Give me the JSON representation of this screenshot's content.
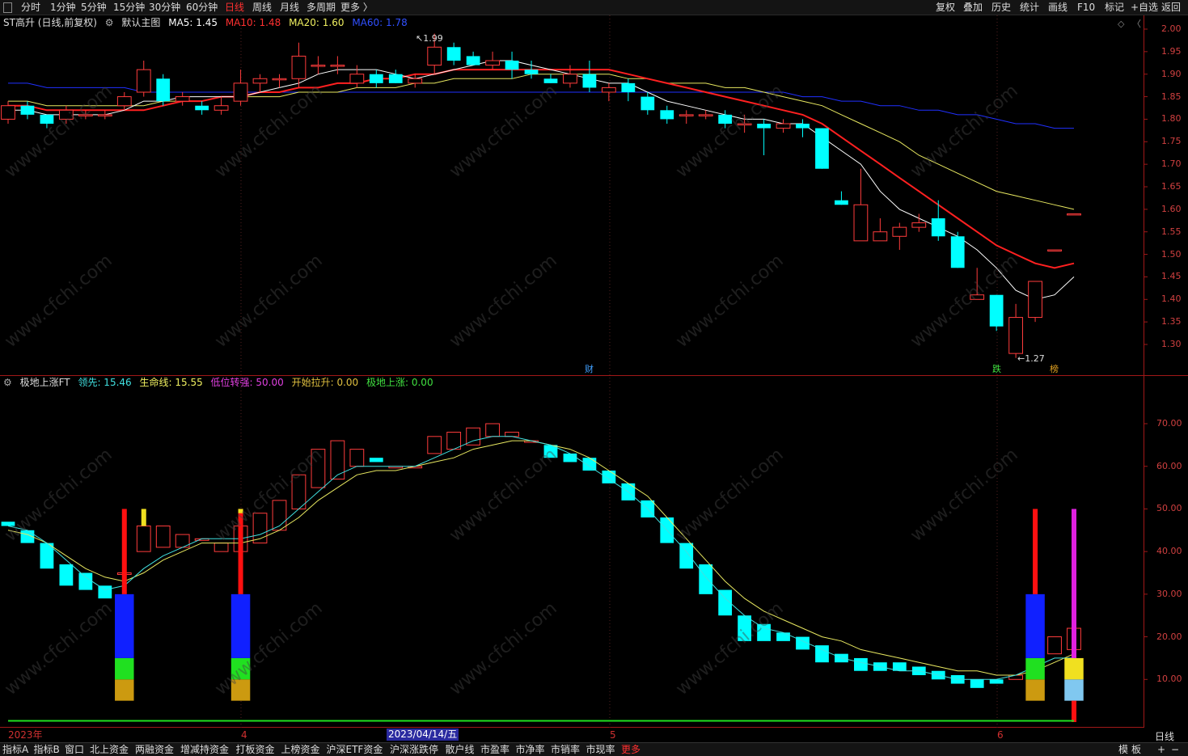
{
  "toolbar": {
    "tabs": [
      "分时",
      "1分钟",
      "5分钟",
      "15分钟",
      "30分钟",
      "60分钟",
      "日线",
      "周线",
      "月线",
      "多周期",
      "更多 〉"
    ],
    "active_tab": "日线",
    "right": [
      "复权",
      "叠加",
      "历史",
      "统计",
      "画线",
      "F10",
      "标记",
      "+自选",
      "返回"
    ]
  },
  "main_chart": {
    "title": "ST高升 (日线,前复权)",
    "template": "默认主图",
    "ma5": "MA5: 1.45",
    "ma10": "MA10: 1.48",
    "ma20": "MA20: 1.60",
    "ma60": "MA60: 1.78",
    "high_label": "1.99",
    "low_label": "1.27",
    "event_marks": [
      "财",
      "跌",
      "榜"
    ],
    "y_ticks": [
      "2.00",
      "1.95",
      "1.90",
      "1.85",
      "1.80",
      "1.75",
      "1.70",
      "1.65",
      "1.60",
      "1.55",
      "1.50",
      "1.45",
      "1.40",
      "1.35",
      "1.30"
    ]
  },
  "indicator": {
    "name": "极地上涨FT",
    "lingxian": "领先: 15.46",
    "shengming": "生命线: 15.55",
    "diwei": "低位转强: 50.00",
    "kaishi": "开始拉升: 0.00",
    "jidi": "极地上涨: 0.00",
    "y_ticks": [
      "70.00",
      "60.00",
      "50.00",
      "40.00",
      "30.00",
      "20.00",
      "10.00"
    ]
  },
  "x_axis": {
    "labels": [
      "2023年",
      "4",
      "5",
      "6"
    ],
    "cursor_date": "2023/04/14/五",
    "period": "日线"
  },
  "bottom_tabs": [
    "指标A",
    "指标B",
    "窗口",
    "北上资金",
    "两融资金",
    "增减持资金",
    "打板资金",
    "上榜资金",
    "沪深ETF资金",
    "沪深涨跌停",
    "散户线",
    "市盈率",
    "市净率",
    "市销率",
    "市现率",
    "更多"
  ],
  "bottom_right": [
    "模",
    "板",
    "+",
    "−"
  ],
  "watermark": "www.cfchi.com",
  "colors": {
    "up": "#ff3c3c",
    "down": "#00ffff",
    "ma5": "#ffffff",
    "ma10": "#ff2020",
    "ma20": "#e8e860",
    "ma60": "#2030ff"
  },
  "chart_data": [
    {
      "type": "candlestick",
      "ylim": [
        1.25,
        2.02
      ],
      "candles": [
        {
          "o": 1.8,
          "h": 1.84,
          "l": 1.79,
          "c": 1.83
        },
        {
          "o": 1.83,
          "h": 1.84,
          "l": 1.8,
          "c": 1.81
        },
        {
          "o": 1.81,
          "h": 1.81,
          "l": 1.78,
          "c": 1.79
        },
        {
          "o": 1.8,
          "h": 1.83,
          "l": 1.79,
          "c": 1.82
        },
        {
          "o": 1.81,
          "h": 1.82,
          "l": 1.8,
          "c": 1.81
        },
        {
          "o": 1.81,
          "h": 1.82,
          "l": 1.8,
          "c": 1.81
        },
        {
          "o": 1.83,
          "h": 1.86,
          "l": 1.82,
          "c": 1.85
        },
        {
          "o": 1.86,
          "h": 1.93,
          "l": 1.85,
          "c": 1.91
        },
        {
          "o": 1.89,
          "h": 1.9,
          "l": 1.83,
          "c": 1.84
        },
        {
          "o": 1.84,
          "h": 1.86,
          "l": 1.83,
          "c": 1.85
        },
        {
          "o": 1.83,
          "h": 1.84,
          "l": 1.81,
          "c": 1.82
        },
        {
          "o": 1.82,
          "h": 1.85,
          "l": 1.81,
          "c": 1.83
        },
        {
          "o": 1.84,
          "h": 1.91,
          "l": 1.83,
          "c": 1.88
        },
        {
          "o": 1.88,
          "h": 1.9,
          "l": 1.86,
          "c": 1.89
        },
        {
          "o": 1.89,
          "h": 1.9,
          "l": 1.87,
          "c": 1.89
        },
        {
          "o": 1.89,
          "h": 1.97,
          "l": 1.87,
          "c": 1.94
        },
        {
          "o": 1.92,
          "h": 1.94,
          "l": 1.9,
          "c": 1.92
        },
        {
          "o": 1.92,
          "h": 1.94,
          "l": 1.9,
          "c": 1.92
        },
        {
          "o": 1.88,
          "h": 1.92,
          "l": 1.87,
          "c": 1.9
        },
        {
          "o": 1.9,
          "h": 1.91,
          "l": 1.87,
          "c": 1.88
        },
        {
          "o": 1.9,
          "h": 1.91,
          "l": 1.88,
          "c": 1.88
        },
        {
          "o": 1.88,
          "h": 1.9,
          "l": 1.87,
          "c": 1.89
        },
        {
          "o": 1.92,
          "h": 1.99,
          "l": 1.9,
          "c": 1.96
        },
        {
          "o": 1.96,
          "h": 1.97,
          "l": 1.92,
          "c": 1.93
        },
        {
          "o": 1.94,
          "h": 1.95,
          "l": 1.92,
          "c": 1.92
        },
        {
          "o": 1.92,
          "h": 1.95,
          "l": 1.91,
          "c": 1.93
        },
        {
          "o": 1.93,
          "h": 1.95,
          "l": 1.89,
          "c": 1.91
        },
        {
          "o": 1.91,
          "h": 1.93,
          "l": 1.89,
          "c": 1.9
        },
        {
          "o": 1.89,
          "h": 1.9,
          "l": 1.88,
          "c": 1.88
        },
        {
          "o": 1.88,
          "h": 1.92,
          "l": 1.87,
          "c": 1.9
        },
        {
          "o": 1.9,
          "h": 1.93,
          "l": 1.86,
          "c": 1.87
        },
        {
          "o": 1.86,
          "h": 1.88,
          "l": 1.84,
          "c": 1.87
        },
        {
          "o": 1.88,
          "h": 1.89,
          "l": 1.84,
          "c": 1.86
        },
        {
          "o": 1.85,
          "h": 1.86,
          "l": 1.81,
          "c": 1.82
        },
        {
          "o": 1.82,
          "h": 1.83,
          "l": 1.79,
          "c": 1.8
        },
        {
          "o": 1.81,
          "h": 1.82,
          "l": 1.79,
          "c": 1.81
        },
        {
          "o": 1.81,
          "h": 1.82,
          "l": 1.8,
          "c": 1.81
        },
        {
          "o": 1.81,
          "h": 1.82,
          "l": 1.78,
          "c": 1.79
        },
        {
          "o": 1.79,
          "h": 1.81,
          "l": 1.77,
          "c": 1.79
        },
        {
          "o": 1.79,
          "h": 1.8,
          "l": 1.72,
          "c": 1.78
        },
        {
          "o": 1.78,
          "h": 1.8,
          "l": 1.77,
          "c": 1.79
        },
        {
          "o": 1.79,
          "h": 1.8,
          "l": 1.76,
          "c": 1.78
        },
        {
          "o": 1.78,
          "h": 1.78,
          "l": 1.69,
          "c": 1.69
        },
        {
          "o": 1.62,
          "h": 1.64,
          "l": 1.61,
          "c": 1.61
        },
        {
          "o": 1.53,
          "h": 1.69,
          "l": 1.53,
          "c": 1.61
        },
        {
          "o": 1.53,
          "h": 1.58,
          "l": 1.53,
          "c": 1.55
        },
        {
          "o": 1.54,
          "h": 1.57,
          "l": 1.51,
          "c": 1.56
        },
        {
          "o": 1.56,
          "h": 1.59,
          "l": 1.55,
          "c": 1.57
        },
        {
          "o": 1.58,
          "h": 1.62,
          "l": 1.53,
          "c": 1.54
        },
        {
          "o": 1.54,
          "h": 1.55,
          "l": 1.47,
          "c": 1.47
        },
        {
          "o": 1.4,
          "h": 1.47,
          "l": 1.4,
          "c": 1.41
        },
        {
          "o": 1.41,
          "h": 1.41,
          "l": 1.33,
          "c": 1.34
        },
        {
          "o": 1.28,
          "h": 1.39,
          "l": 1.27,
          "c": 1.36
        },
        {
          "o": 1.36,
          "h": 1.44,
          "l": 1.35,
          "c": 1.44
        },
        {
          "o": 1.51,
          "h": 1.51,
          "l": 1.51,
          "c": 1.51
        },
        {
          "o": 1.59,
          "h": 1.59,
          "l": 1.59,
          "c": 1.59
        }
      ],
      "ma5": [
        1.82,
        1.82,
        1.81,
        1.81,
        1.81,
        1.81,
        1.82,
        1.84,
        1.84,
        1.85,
        1.85,
        1.85,
        1.85,
        1.86,
        1.87,
        1.88,
        1.9,
        1.91,
        1.91,
        1.91,
        1.9,
        1.89,
        1.9,
        1.91,
        1.92,
        1.93,
        1.93,
        1.92,
        1.91,
        1.9,
        1.89,
        1.88,
        1.88,
        1.86,
        1.84,
        1.83,
        1.82,
        1.81,
        1.8,
        1.8,
        1.79,
        1.79,
        1.76,
        1.73,
        1.7,
        1.64,
        1.6,
        1.58,
        1.56,
        1.54,
        1.51,
        1.47,
        1.42,
        1.4,
        1.41,
        1.45
      ],
      "ma10": [
        1.83,
        1.83,
        1.82,
        1.82,
        1.82,
        1.82,
        1.82,
        1.82,
        1.83,
        1.84,
        1.84,
        1.85,
        1.85,
        1.86,
        1.86,
        1.87,
        1.87,
        1.88,
        1.88,
        1.89,
        1.89,
        1.9,
        1.9,
        1.91,
        1.91,
        1.91,
        1.91,
        1.91,
        1.91,
        1.91,
        1.91,
        1.91,
        1.9,
        1.89,
        1.88,
        1.87,
        1.86,
        1.85,
        1.84,
        1.83,
        1.82,
        1.81,
        1.79,
        1.76,
        1.73,
        1.7,
        1.67,
        1.64,
        1.61,
        1.58,
        1.55,
        1.52,
        1.5,
        1.48,
        1.47,
        1.48
      ],
      "ma20": [
        1.84,
        1.84,
        1.83,
        1.83,
        1.83,
        1.83,
        1.83,
        1.83,
        1.84,
        1.84,
        1.84,
        1.85,
        1.85,
        1.85,
        1.85,
        1.86,
        1.86,
        1.86,
        1.87,
        1.87,
        1.87,
        1.88,
        1.88,
        1.89,
        1.89,
        1.89,
        1.89,
        1.9,
        1.9,
        1.9,
        1.9,
        1.9,
        1.89,
        1.89,
        1.88,
        1.88,
        1.88,
        1.87,
        1.87,
        1.86,
        1.85,
        1.84,
        1.83,
        1.81,
        1.79,
        1.77,
        1.75,
        1.72,
        1.7,
        1.68,
        1.66,
        1.64,
        1.63,
        1.62,
        1.61,
        1.6
      ],
      "ma60": [
        1.88,
        1.88,
        1.87,
        1.87,
        1.87,
        1.87,
        1.87,
        1.86,
        1.86,
        1.86,
        1.86,
        1.86,
        1.86,
        1.86,
        1.86,
        1.86,
        1.86,
        1.86,
        1.86,
        1.86,
        1.86,
        1.86,
        1.86,
        1.86,
        1.86,
        1.86,
        1.86,
        1.86,
        1.86,
        1.86,
        1.86,
        1.86,
        1.86,
        1.86,
        1.86,
        1.86,
        1.86,
        1.86,
        1.86,
        1.86,
        1.86,
        1.85,
        1.85,
        1.84,
        1.84,
        1.83,
        1.83,
        1.82,
        1.82,
        1.81,
        1.81,
        1.8,
        1.79,
        1.79,
        1.78,
        1.78
      ]
    },
    {
      "type": "bar",
      "ylim": [
        0,
        80
      ],
      "bars": [
        {
          "o": 47,
          "c": 46
        },
        {
          "o": 45,
          "c": 42
        },
        {
          "o": 42,
          "c": 36
        },
        {
          "o": 37,
          "c": 32
        },
        {
          "o": 35,
          "c": 31
        },
        {
          "o": 32,
          "c": 29
        },
        {
          "o": 35,
          "c": 35
        },
        {
          "o": 40,
          "c": 46
        },
        {
          "o": 41,
          "c": 46
        },
        {
          "o": 41,
          "c": 44
        },
        {
          "o": 43,
          "c": 43
        },
        {
          "o": 40,
          "c": 42
        },
        {
          "o": 40,
          "c": 46
        },
        {
          "o": 42,
          "c": 49
        },
        {
          "o": 45,
          "c": 52
        },
        {
          "o": 50,
          "c": 58
        },
        {
          "o": 55,
          "c": 64
        },
        {
          "o": 57,
          "c": 66
        },
        {
          "o": 60,
          "c": 64
        },
        {
          "o": 62,
          "c": 61
        },
        {
          "o": 60,
          "c": 60
        },
        {
          "o": 60,
          "c": 60
        },
        {
          "o": 63,
          "c": 67
        },
        {
          "o": 64,
          "c": 68
        },
        {
          "o": 65,
          "c": 69
        },
        {
          "o": 67,
          "c": 70
        },
        {
          "o": 67,
          "c": 68
        },
        {
          "o": 66,
          "c": 66
        },
        {
          "o": 65,
          "c": 62
        },
        {
          "o": 63,
          "c": 61
        },
        {
          "o": 62,
          "c": 59
        },
        {
          "o": 59,
          "c": 56
        },
        {
          "o": 56,
          "c": 52
        },
        {
          "o": 52,
          "c": 48
        },
        {
          "o": 48,
          "c": 42
        },
        {
          "o": 42,
          "c": 36
        },
        {
          "o": 37,
          "c": 30
        },
        {
          "o": 31,
          "c": 25
        },
        {
          "o": 25,
          "c": 19
        },
        {
          "o": 23,
          "c": 19
        },
        {
          "o": 21,
          "c": 19
        },
        {
          "o": 20,
          "c": 17
        },
        {
          "o": 18,
          "c": 14
        },
        {
          "o": 16,
          "c": 14
        },
        {
          "o": 15,
          "c": 12
        },
        {
          "o": 14,
          "c": 12
        },
        {
          "o": 14,
          "c": 12
        },
        {
          "o": 13,
          "c": 11
        },
        {
          "o": 12,
          "c": 10
        },
        {
          "o": 11,
          "c": 9
        },
        {
          "o": 10,
          "c": 8
        },
        {
          "o": 10,
          "c": 9
        },
        {
          "o": 10,
          "c": 11
        },
        {
          "o": 11,
          "c": 17
        },
        {
          "o": 16,
          "c": 20
        },
        {
          "o": 17,
          "c": 22
        }
      ],
      "leading_line": [
        46,
        45,
        42,
        38,
        34,
        31,
        32,
        36,
        39,
        41,
        43,
        43,
        43,
        44,
        46,
        50,
        54,
        58,
        60,
        60,
        60,
        60,
        62,
        64,
        66,
        67,
        67,
        66,
        65,
        63,
        60,
        57,
        54,
        50,
        45,
        40,
        34,
        29,
        25,
        22,
        21,
        19,
        17,
        15,
        14,
        13,
        12,
        12,
        11,
        10,
        10,
        10,
        11,
        13,
        15,
        15
      ],
      "life_line": [
        45,
        44,
        42,
        39,
        36,
        34,
        33,
        35,
        38,
        40,
        42,
        42,
        42,
        43,
        45,
        48,
        52,
        55,
        58,
        59,
        59,
        60,
        61,
        62,
        64,
        65,
        66,
        66,
        65,
        64,
        62,
        59,
        56,
        53,
        48,
        43,
        38,
        33,
        29,
        26,
        24,
        22,
        20,
        19,
        17,
        16,
        15,
        14,
        13,
        12,
        12,
        11,
        11,
        12,
        14,
        16
      ],
      "signals": [
        {
          "index": 6,
          "tall": 50,
          "segments": [
            [
              "#cc9a10",
              5,
              10
            ],
            [
              "#20e020",
              10,
              15
            ],
            [
              "#1020ff",
              15,
              30
            ],
            [
              "#ff1010",
              30,
              50
            ]
          ]
        },
        {
          "index": 12,
          "tall": 50,
          "segments": [
            [
              "#cc9a10",
              5,
              10
            ],
            [
              "#20e020",
              10,
              15
            ],
            [
              "#1020ff",
              15,
              30
            ],
            [
              "#ff1010",
              30,
              50
            ]
          ]
        },
        {
          "index": 53,
          "tall": 50,
          "segments": [
            [
              "#cc9a10",
              5,
              10
            ],
            [
              "#20e020",
              10,
              15
            ],
            [
              "#1020ff",
              15,
              30
            ],
            [
              "#ff1010",
              30,
              50
            ]
          ]
        },
        {
          "index": 55,
          "tall": 50,
          "segments": [
            [
              "#80c8f0",
              5,
              10
            ],
            [
              "#f0e020",
              10,
              15
            ],
            [
              "#e020e0",
              15,
              50
            ]
          ],
          "red_below": true
        }
      ]
    }
  ]
}
